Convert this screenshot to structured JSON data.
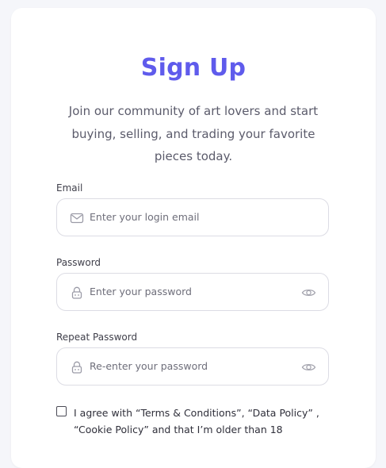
{
  "signup": {
    "title": "Sign Up",
    "subtitle": "Join our community of art lovers and start buying, selling, and trading your favorite pieces today.",
    "email": {
      "label": "Email",
      "placeholder": "Enter your login email",
      "icon": "mail-icon"
    },
    "password": {
      "label": "Password",
      "placeholder": "Enter your password",
      "icon": "lock-icon",
      "toggle_icon": "eye-icon"
    },
    "repeat_password": {
      "label": "Repeat Password",
      "placeholder": "Re-enter your password",
      "icon": "lock-icon",
      "toggle_icon": "eye-icon"
    },
    "agree_text": "I agree with “Terms & Conditions”, “Data Policy” , “Cookie Policy” and that I’m older than 18"
  },
  "colors": {
    "accent": "#5f5bec",
    "background": "#f5f6fa",
    "card": "#ffffff",
    "border": "#dcdce4"
  }
}
